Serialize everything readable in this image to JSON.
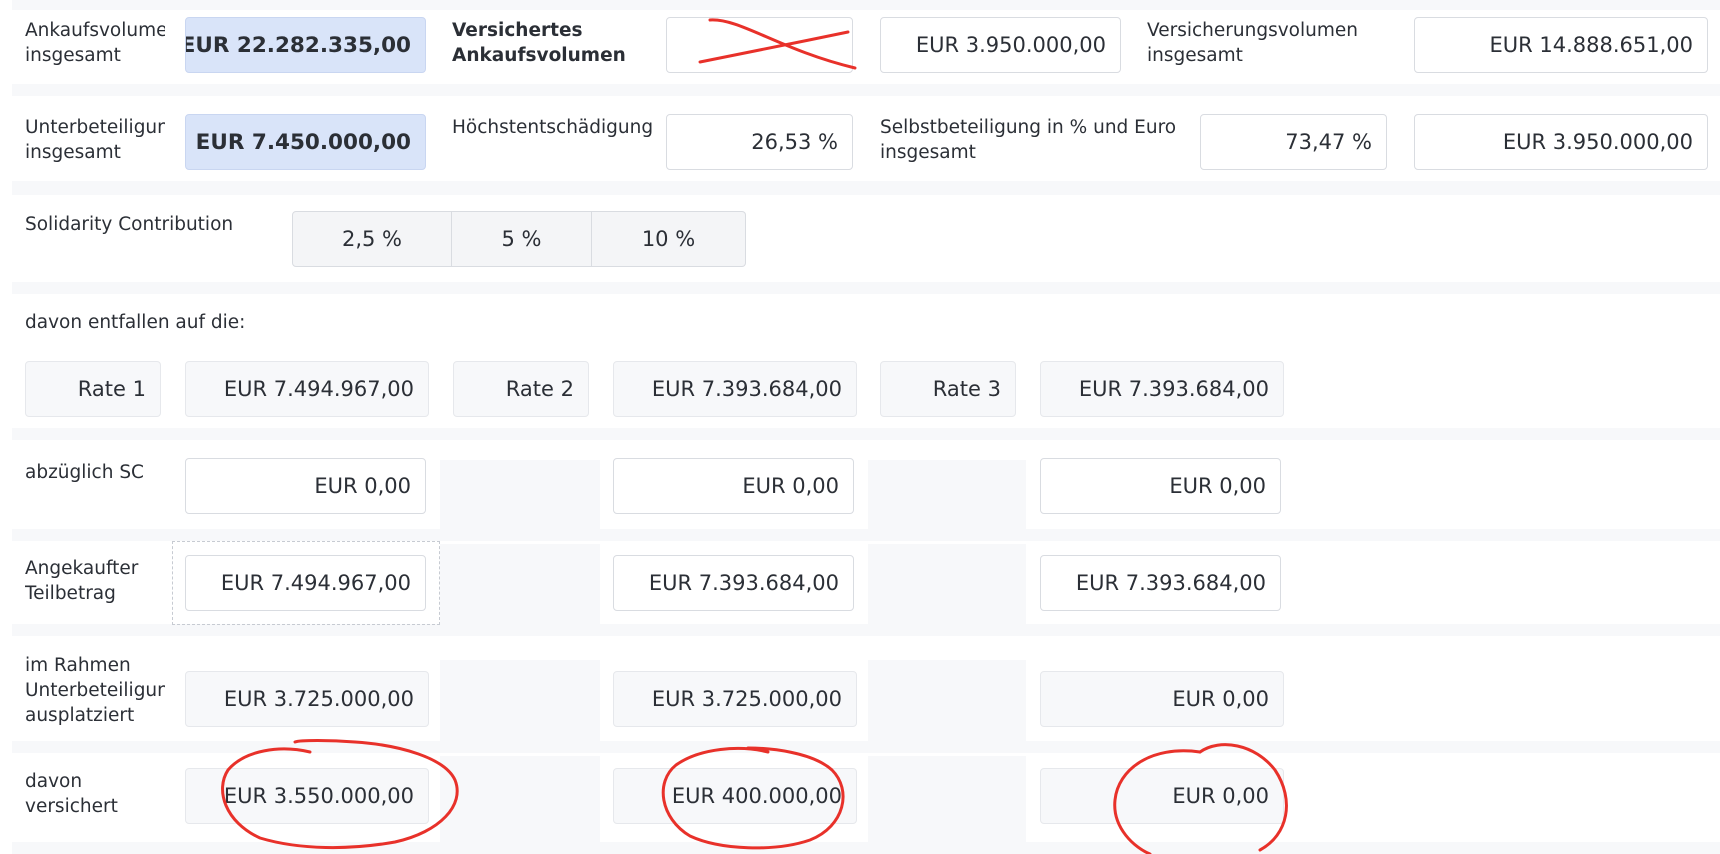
{
  "row1": {
    "ankaufsvolumen_label": "Ankaufsvolumen insgesamt",
    "ankaufsvolumen_value": "EUR 22.282.335,00",
    "versichertes_label": "Versichertes Ankaufsvolumen",
    "versichertes_value": "",
    "versichertes_amount": "EUR 3.950.000,00",
    "versicherungsvolumen_label": "Versicherungsvolumen insgesamt",
    "versicherungsvolumen_value": "EUR 14.888.651,00"
  },
  "row2": {
    "unterbeteiligung_label": "Unterbeteiligung insgesamt",
    "unterbeteiligung_value": "EUR 7.450.000,00",
    "hoechst_label": "Höchstentschädigung",
    "hoechst_value": "26,53 %",
    "selbst_label": "Selbstbeteiligung in % und Euro insgesamt",
    "selbst_percent": "73,47 %",
    "selbst_amount": "EUR 3.950.000,00"
  },
  "solidarity": {
    "label": "Solidarity Contribution",
    "options": [
      "2,5 %",
      "5 %",
      "10 %"
    ]
  },
  "davon_entfallen_label": "davon entfallen auf die:",
  "rates": [
    {
      "label": "Rate 1",
      "value": "EUR 7.494.967,00",
      "abzueglich_sc": "EUR 0,00",
      "angekauft": "EUR 7.494.967,00",
      "ausplatziert": "EUR 3.725.000,00",
      "versichert": "EUR 3.550.000,00"
    },
    {
      "label": "Rate 2",
      "value": "EUR 7.393.684,00",
      "abzueglich_sc": "EUR 0,00",
      "angekauft": "EUR 7.393.684,00",
      "ausplatziert": "EUR 3.725.000,00",
      "versichert": "EUR 400.000,00"
    },
    {
      "label": "Rate 3",
      "value": "EUR 7.393.684,00",
      "abzueglich_sc": "EUR 0,00",
      "angekauft": "EUR 7.393.684,00",
      "ausplatziert": "EUR 0,00",
      "versichert": "EUR 0,00"
    }
  ],
  "row_labels": {
    "abzueglich_sc": "abzüglich SC",
    "angekauft": "Angekaufter Teilbetrag",
    "ausplatziert": "im Rahmen Unterbeteiligung ausplatziert",
    "versichert": "davon versichert"
  },
  "colors": {
    "highlight_field": "#d9e4f9",
    "annotation_red": "#e8312a"
  }
}
